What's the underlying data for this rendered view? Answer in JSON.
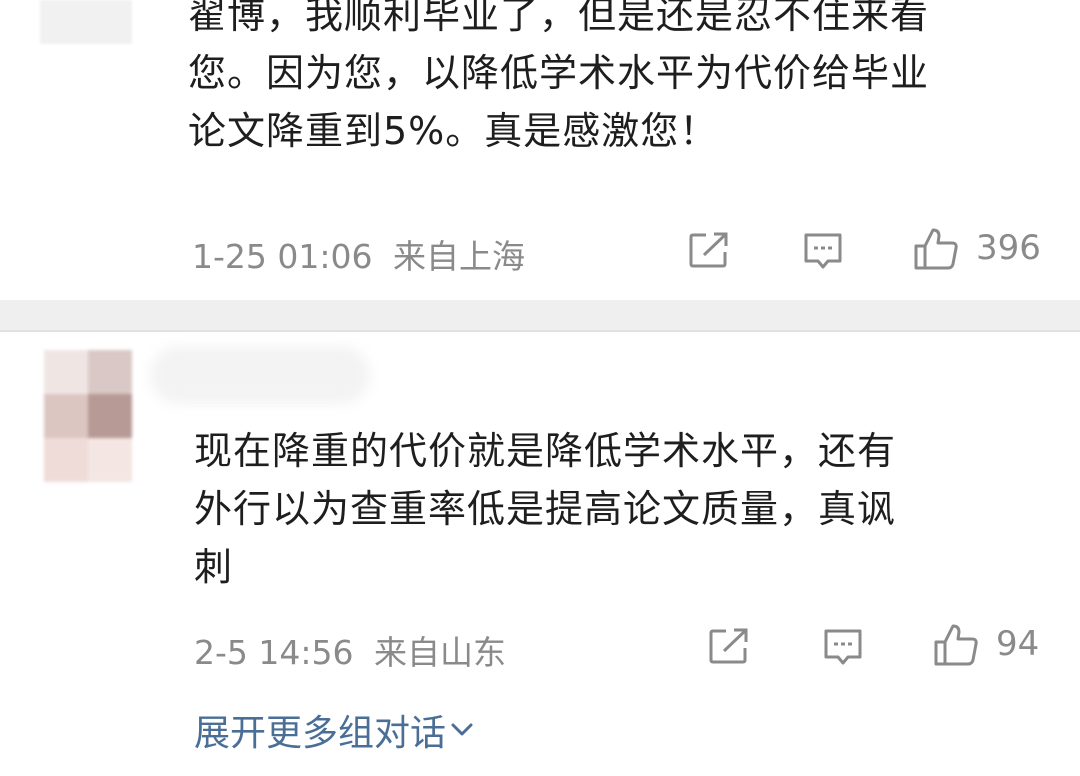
{
  "comment1": {
    "text": "翟博，我顺利毕业了，但是还是忍不住来看\n您。因为您，以降低学术水平为代价给毕业\n论文降重到5%。真是感激您！",
    "time": "1-25 01:06",
    "location": "来自上海",
    "likes": "396"
  },
  "comment2": {
    "text": "现在降重的代价就是降低学术水平，还有\n外行以为查重率低是提高论文质量，真讽\n刺",
    "time": "2-5 14:56",
    "location": "来自山东",
    "likes": "94"
  },
  "expand": {
    "label": "展开更多组对话"
  },
  "icons": {
    "share": "share-icon",
    "reply": "comment-icon",
    "like": "thumbs-up-icon",
    "expand": "chevron-down-icon"
  },
  "colors": {
    "text": "#1e1e1e",
    "meta": "#8a8a8a",
    "link": "#4a6e96",
    "divider": "#efefef"
  }
}
